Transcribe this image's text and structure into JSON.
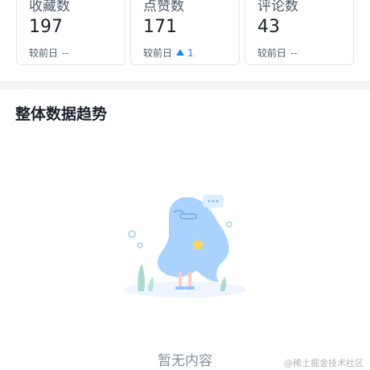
{
  "stats": [
    {
      "title": "收藏数",
      "value": "197",
      "compare_label": "较前日",
      "delta": "--",
      "trend": "none"
    },
    {
      "title": "点赞数",
      "value": "171",
      "compare_label": "较前日",
      "delta": "1",
      "trend": "up"
    },
    {
      "title": "评论数",
      "value": "43",
      "compare_label": "较前日",
      "delta": "--",
      "trend": "none"
    }
  ],
  "trend_section": {
    "title": "整体数据趋势",
    "empty_text": "暂无内容",
    "illustration_icon": "empty-ghost-illustration"
  },
  "watermark": "@稀土掘金技术社区",
  "colors": {
    "accent": "#1e80ff",
    "ghost": "#a9d2ff",
    "band": "#f2f3f5"
  }
}
